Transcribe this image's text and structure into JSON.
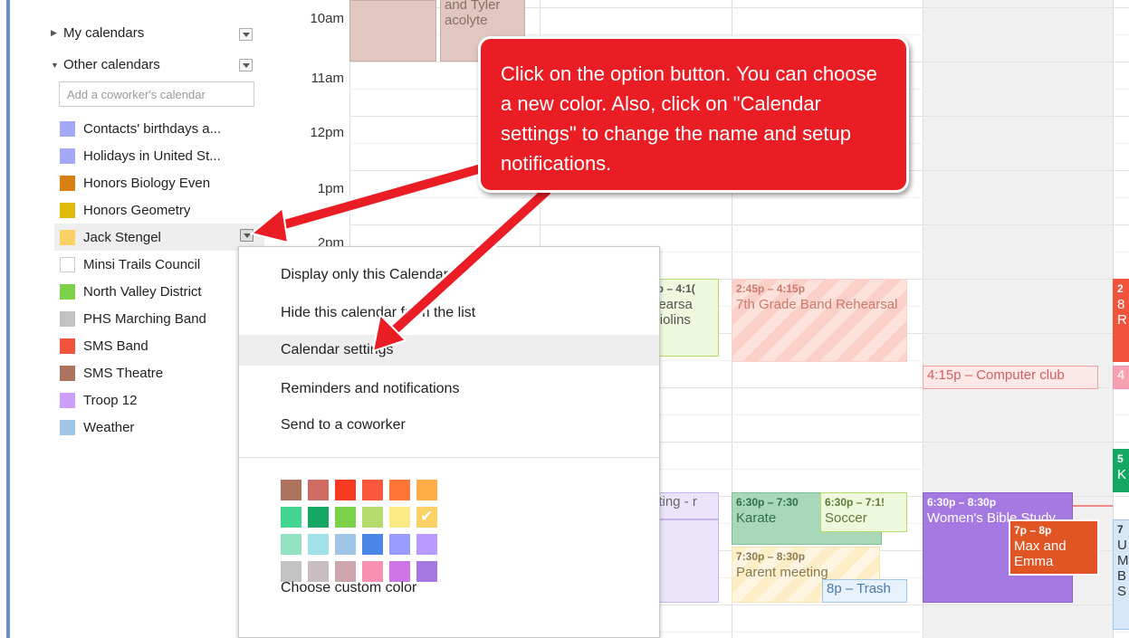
{
  "sidebar": {
    "my_calendars_label": "My calendars",
    "other_calendars_label": "Other calendars",
    "coworker_placeholder": "Add a coworker's calendar",
    "calendars": [
      {
        "label": "Contacts' birthdays a...",
        "color": "#a4a9f7"
      },
      {
        "label": "Holidays in United St...",
        "color": "#a4a9f7"
      },
      {
        "label": "Honors Biology Even",
        "color": "#d98012"
      },
      {
        "label": "Honors Geometry",
        "color": "#e1b90a"
      },
      {
        "label": "Jack Stengel",
        "color": "#fad165",
        "selected": true
      },
      {
        "label": "Minsi Trails Council",
        "color": "#ffffff",
        "empty": true
      },
      {
        "label": "North Valley District",
        "color": "#7bd148"
      },
      {
        "label": "PHS Marching Band",
        "color": "#c2c2c2"
      },
      {
        "label": "SMS Band",
        "color": "#f2533c"
      },
      {
        "label": "SMS Theatre",
        "color": "#ac725e"
      },
      {
        "label": "Troop 12",
        "color": "#cd9ffa"
      },
      {
        "label": "Weather",
        "color": "#9fc6e7"
      }
    ]
  },
  "grid": {
    "times": [
      "10am",
      "11am",
      "12pm",
      "1pm",
      "2pm"
    ]
  },
  "events": {
    "e1": {
      "title": "and Tyler acolyte"
    },
    "e2": {
      "time": "5p – 4:1(",
      "title": "hearsa Violins"
    },
    "e3": {
      "time": "2:45p – 4:15p",
      "title": "7th Grade Band Rehearsal"
    },
    "e4": {
      "text": "4:15p – Computer club"
    },
    "e5": {
      "text": "eting - r"
    },
    "e6": {
      "time": "6:30p – 7:30",
      "title": "Karate"
    },
    "e7": {
      "time": "6:30p – 7:1!",
      "title": "Soccer"
    },
    "e8": {
      "time": "6:30p – 8:30p",
      "title": "Women's Bible Study"
    },
    "e9": {
      "time": "7p – 8p",
      "title": "Max and Emma"
    },
    "e10": {
      "time": "7:30p – 8:30p",
      "title": "Parent meeting"
    },
    "e11": {
      "text": "8p – Trash"
    },
    "e12": {
      "time": "2",
      "title": "8 R"
    },
    "e13": {
      "text": "4"
    },
    "e14": {
      "time": "5",
      "title": "K"
    },
    "e15": {
      "time": "7",
      "title": "U M B S"
    }
  },
  "menu": {
    "items": [
      {
        "label": "Display only this Calendar"
      },
      {
        "label": "Hide this calendar from the list"
      },
      {
        "label": "Calendar settings"
      },
      {
        "label": "Reminders and notifications"
      },
      {
        "label": "Send to a coworker"
      }
    ],
    "custom_color_label": "Choose custom color",
    "palette": [
      [
        "#ac725e",
        "#d06b64",
        "#f83a22",
        "#fa573c",
        "#ff7537",
        "#ffad46"
      ],
      [
        "#42d692",
        "#16a765",
        "#7bd148",
        "#b3dc6c",
        "#fbe983",
        "#fad165"
      ],
      [
        "#92e1c0",
        "#9fe1e7",
        "#9fc6e7",
        "#4986e7",
        "#9a9cff",
        "#b99aff"
      ],
      [
        "#c2c2c2",
        "#cabdbf",
        "#cca6ac",
        "#f691b2",
        "#cd74e6",
        "#a47ae2"
      ]
    ],
    "selected_color": "#fad165"
  },
  "callout": {
    "text": "Click on the option button.  You can choose a new color.  Also, click on \"Calendar settings\" to change the name and setup notifications."
  },
  "colors": {
    "annotation_red": "#ea1c24",
    "sidebar_strip": "#6b8fd6"
  }
}
